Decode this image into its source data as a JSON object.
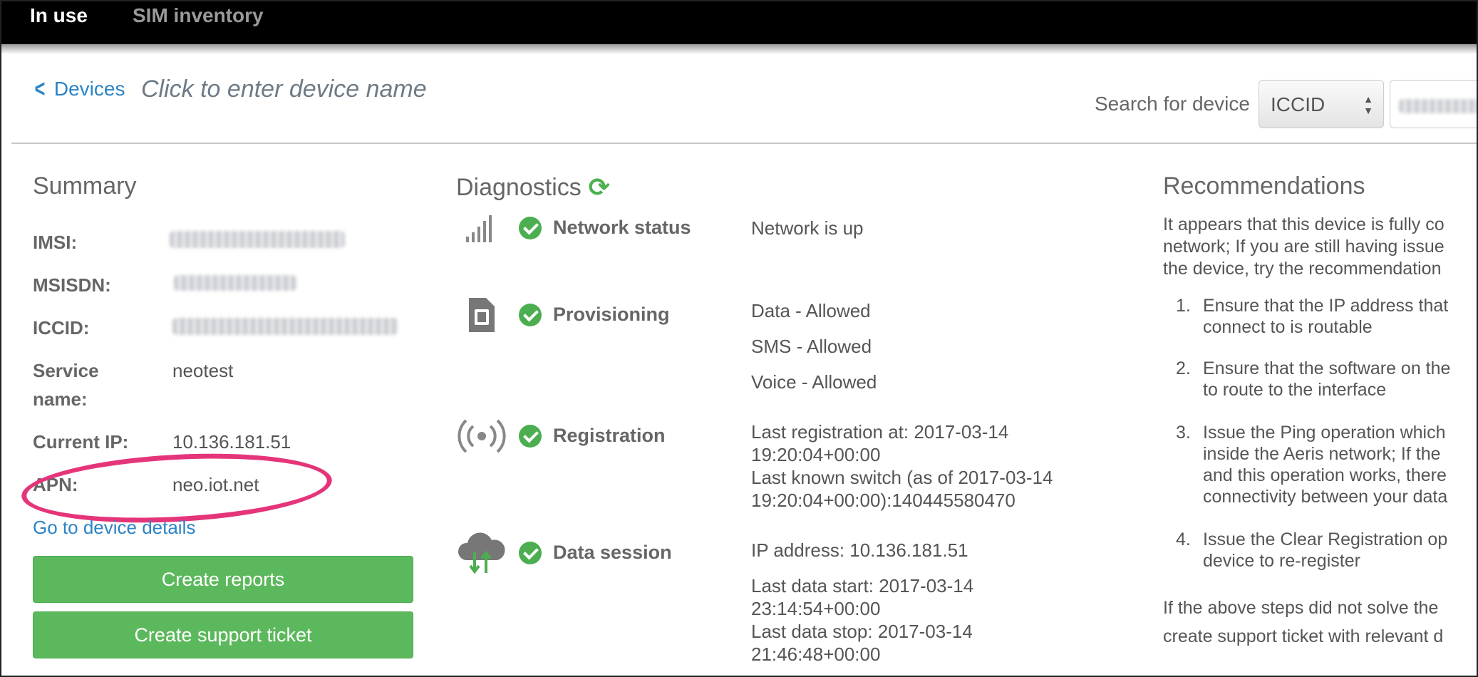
{
  "tabs": [
    "In use",
    "SIM inventory"
  ],
  "header": {
    "back_label": "Devices",
    "device_name_placeholder": "Click to enter device name",
    "search_label": "Search for device",
    "search_type": "ICCID"
  },
  "summary": {
    "title": "Summary",
    "rows": [
      {
        "label": "IMSI:",
        "value": ""
      },
      {
        "label": "MSISDN:",
        "value": ""
      },
      {
        "label": "ICCID:",
        "value": ""
      },
      {
        "label": "Service name:",
        "value": "neotest"
      },
      {
        "label": "Current IP:",
        "value": "10.136.181.51"
      },
      {
        "label": "APN:",
        "value": "neo.iot.net"
      }
    ],
    "details_link": "Go to device details",
    "buttons": [
      "Create reports",
      "Create support ticket"
    ],
    "highlight_color": "#e5357a"
  },
  "diagnostics": {
    "title": "Diagnostics",
    "items": [
      {
        "icon": "signal-bars-icon",
        "label": "Network status",
        "lines": [
          "Network is up"
        ]
      },
      {
        "icon": "sim-card-icon",
        "label": "Provisioning",
        "lines": [
          "Data - Allowed",
          "SMS - Allowed",
          "Voice - Allowed"
        ]
      },
      {
        "icon": "broadcast-icon",
        "label": "Registration",
        "lines": [
          "Last registration at: 2017-03-14",
          "19:20:04+00:00",
          "Last known switch (as of 2017-03-14",
          "19:20:04+00:00):140445580470"
        ]
      },
      {
        "icon": "cloud-transfer-icon",
        "label": "Data session",
        "lines": [
          "IP address: 10.136.181.51",
          "Last data start: 2017-03-14",
          "23:14:54+00:00",
          "Last data stop: 2017-03-14",
          "21:46:48+00:00"
        ]
      }
    ],
    "status_color": "#4cae50"
  },
  "recommendations": {
    "title": "Recommendations",
    "intro": [
      "It appears that this device is fully co",
      "network; If you are still having issue",
      "the device, try the recommendation"
    ],
    "items": [
      {
        "num": "1.",
        "lines": [
          "Ensure that the IP address that",
          "connect to is routable"
        ]
      },
      {
        "num": "2.",
        "lines": [
          "Ensure that the software on the",
          "to route to the interface"
        ]
      },
      {
        "num": "3.",
        "lines": [
          "Issue the Ping operation which",
          "inside the Aeris network; If the",
          "and this operation works, there",
          "connectivity between your data"
        ]
      },
      {
        "num": "4.",
        "lines": [
          "Issue the Clear Registration op",
          "device to re-register"
        ]
      }
    ],
    "footer": [
      "If the above steps did not solve the",
      "create support ticket with relevant d"
    ]
  }
}
